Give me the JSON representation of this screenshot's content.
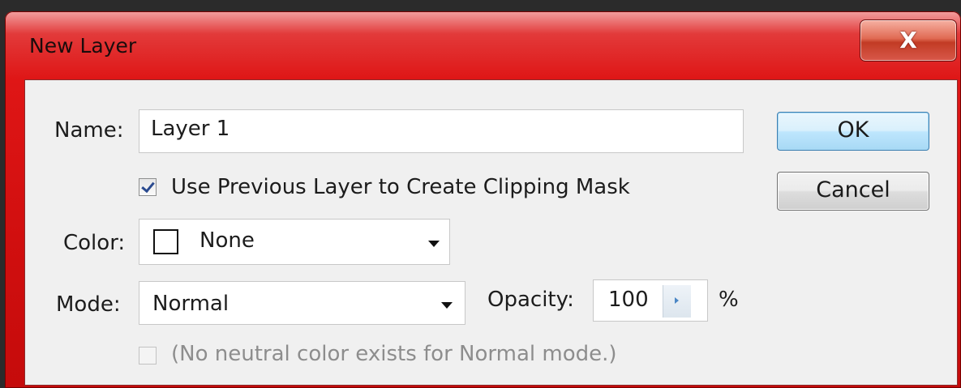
{
  "window": {
    "title": "New Layer",
    "close_glyph": "X"
  },
  "form": {
    "name_label": "Name:",
    "name_value": "Layer 1",
    "clipping_label": "Use Previous Layer to Create Clipping Mask",
    "clipping_checked": true,
    "color_label": "Color:",
    "color_value": "None",
    "mode_label": "Mode:",
    "mode_value": "Normal",
    "opacity_label": "Opacity:",
    "opacity_value": "100",
    "opacity_unit": "%",
    "neutral_label": "(No neutral color exists for Normal mode.)",
    "neutral_enabled": false
  },
  "buttons": {
    "ok": "OK",
    "cancel": "Cancel"
  },
  "colors": {
    "titlebar": "#d10f0f",
    "client_bg": "#f0f0f0",
    "ok_border": "#3c7fb1"
  },
  "icons": {
    "close": "close-icon",
    "dropdown": "chevron-down-icon",
    "spin": "chevron-right-icon",
    "checkbox": "checkbox-icon",
    "swatch": "color-swatch-icon"
  }
}
